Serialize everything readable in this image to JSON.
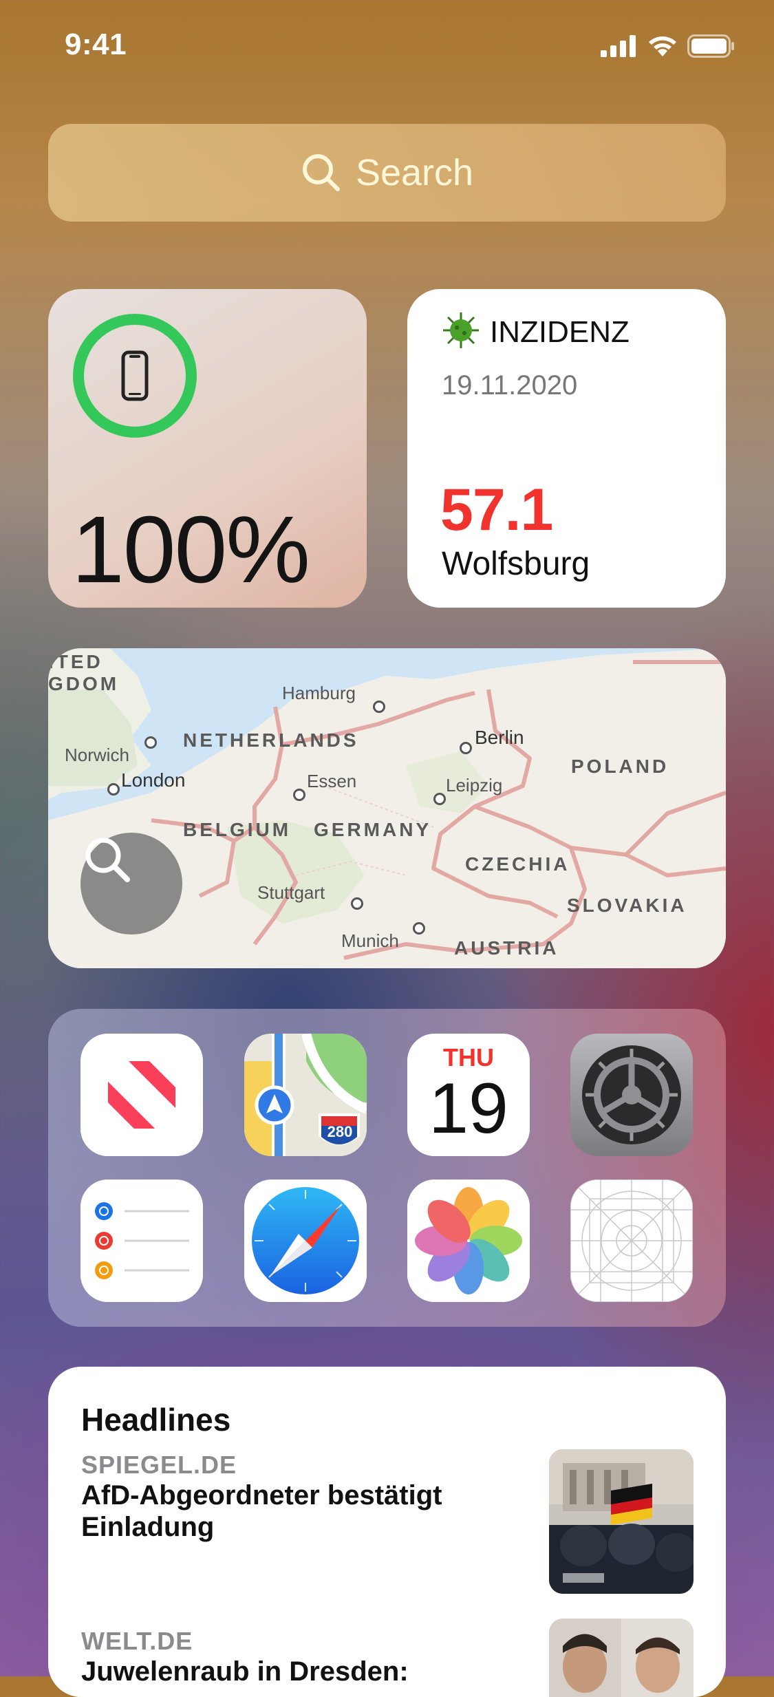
{
  "status_bar": {
    "time": "9:41",
    "icons": [
      "cellular-signal-icon",
      "wifi-icon",
      "battery-icon"
    ]
  },
  "search": {
    "label": "Search",
    "icon": "search-icon"
  },
  "battery_widget": {
    "percent": "100%",
    "level": 1.0,
    "device_icon": "iphone-icon",
    "ring_color": "#34c759"
  },
  "inzidenz_widget": {
    "icon": "virus-icon",
    "title": "INZIDENZ",
    "date": "19.11.2020",
    "value": "57.1",
    "city": "Wolfsburg",
    "value_color": "#f2322c"
  },
  "map_widget": {
    "edge_labels": [
      "ITED",
      "GDOM"
    ],
    "cities": [
      "Hamburg",
      "Norwich",
      "London",
      "Berlin",
      "Essen",
      "Leipzig",
      "Stuttgart",
      "Munich"
    ],
    "countries": [
      "NETHERLANDS",
      "POLAND",
      "BELGIUM",
      "GERMANY",
      "CZECHIA",
      "SLOVAKIA",
      "AUSTRIA"
    ],
    "search_icon": "search-icon"
  },
  "apps_widget": {
    "apps": [
      {
        "name": "News",
        "icon": "news-icon"
      },
      {
        "name": "Maps",
        "icon": "maps-icon",
        "shield": "280"
      },
      {
        "name": "Calendar",
        "icon": "calendar-icon",
        "day": "THU",
        "date": "19"
      },
      {
        "name": "Settings",
        "icon": "settings-gear-icon"
      },
      {
        "name": "Reminders",
        "icon": "reminders-icon"
      },
      {
        "name": "Safari",
        "icon": "safari-compass-icon"
      },
      {
        "name": "Photos",
        "icon": "photos-flower-icon"
      },
      {
        "name": "App Placeholder",
        "icon": "app-grid-placeholder-icon"
      }
    ]
  },
  "news_widget": {
    "title": "Headlines",
    "items": [
      {
        "source": "SPIEGEL.DE",
        "headline": "AfD-Abgeordneter bestätigt Einladung"
      },
      {
        "source": "WELT.DE",
        "headline": "Juwelenraub in Dresden:"
      }
    ]
  }
}
